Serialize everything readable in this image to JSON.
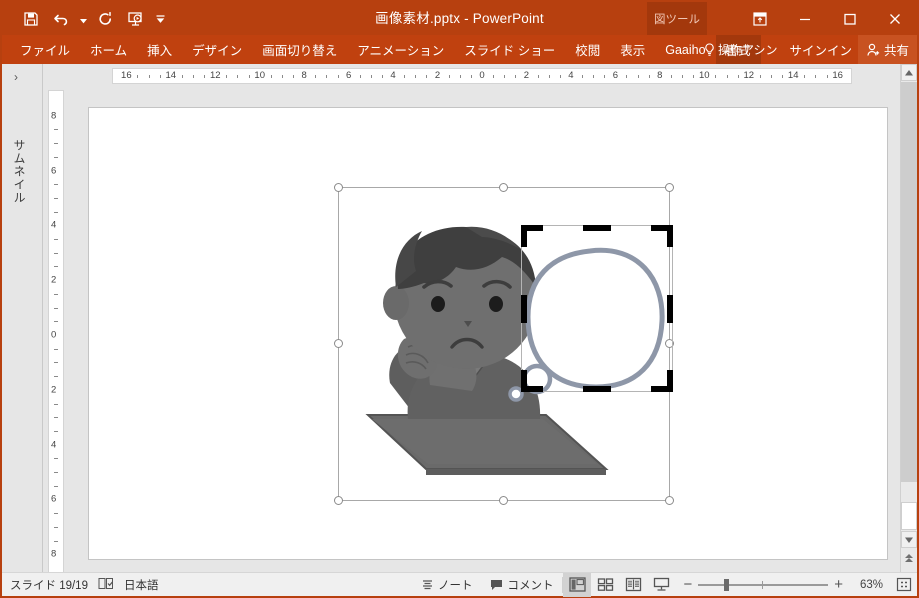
{
  "window": {
    "title": "画像素材.pptx - PowerPoint",
    "contextual_tab_group": "図ツール",
    "accent_color": "#b7400f",
    "ribbon_color": "#c0410f",
    "active_tab_color": "#a3380c"
  },
  "quick_access": [
    {
      "name": "save-icon",
      "label": "保存"
    },
    {
      "name": "undo-icon",
      "label": "元に戻す"
    },
    {
      "name": "redo-icon",
      "label": "やり直し"
    },
    {
      "name": "start-slideshow-icon",
      "label": "先頭から開始"
    },
    {
      "name": "customize-qat-icon",
      "label": "クイック アクセス ツール バーのユーザー設定"
    }
  ],
  "window_controls": [
    {
      "name": "ribbon-display-options-icon",
      "label": "リボンの表示オプション"
    },
    {
      "name": "minimize-icon",
      "label": "最小化"
    },
    {
      "name": "maximize-icon",
      "label": "最大化"
    },
    {
      "name": "close-icon",
      "label": "閉じる"
    }
  ],
  "ribbon": {
    "tabs": [
      {
        "label": "ファイル",
        "active": false
      },
      {
        "label": "ホーム",
        "active": false
      },
      {
        "label": "挿入",
        "active": false
      },
      {
        "label": "デザイン",
        "active": false
      },
      {
        "label": "画面切り替え",
        "active": false
      },
      {
        "label": "アニメーション",
        "active": false
      },
      {
        "label": "スライド ショー",
        "active": false
      },
      {
        "label": "校閲",
        "active": false
      },
      {
        "label": "表示",
        "active": false
      },
      {
        "label": "Gaaiho",
        "active": false
      },
      {
        "label": "書式",
        "active": true
      }
    ],
    "tell_me": "操作アシン",
    "sign_in": "サインイン",
    "share": "共有"
  },
  "thumbnail_pane": {
    "label": "サムネイル",
    "expand_chevron": "›"
  },
  "rulers": {
    "horizontal": [
      "16",
      "14",
      "12",
      "10",
      "8",
      "6",
      "4",
      "2",
      "0",
      "2",
      "4",
      "6",
      "8",
      "10",
      "12",
      "14",
      "16"
    ],
    "vertical": [
      "8",
      "6",
      "4",
      "2",
      "0",
      "2",
      "4",
      "6",
      "8"
    ]
  },
  "slide": {
    "selected_object": "picture-thinking-person",
    "crop_active": true,
    "alt": "考え事をする人のイラスト（吹き出し付き）"
  },
  "status_bar": {
    "slide_counter": "スライド 19/19",
    "language": "日本語",
    "notes": "ノート",
    "comments": "コメント",
    "views": [
      {
        "name": "normal-view-button",
        "label": "標準",
        "active": true
      },
      {
        "name": "slide-sorter-view-button",
        "label": "スライド一覧",
        "active": false
      },
      {
        "name": "reading-view-button",
        "label": "閲覧表示",
        "active": false
      },
      {
        "name": "slideshow-view-button",
        "label": "スライド ショー",
        "active": false
      }
    ],
    "zoom_out": "−",
    "zoom_in": "+",
    "zoom_level": "63%",
    "fit_to_window": "現在のウィンドウに合わせる"
  }
}
